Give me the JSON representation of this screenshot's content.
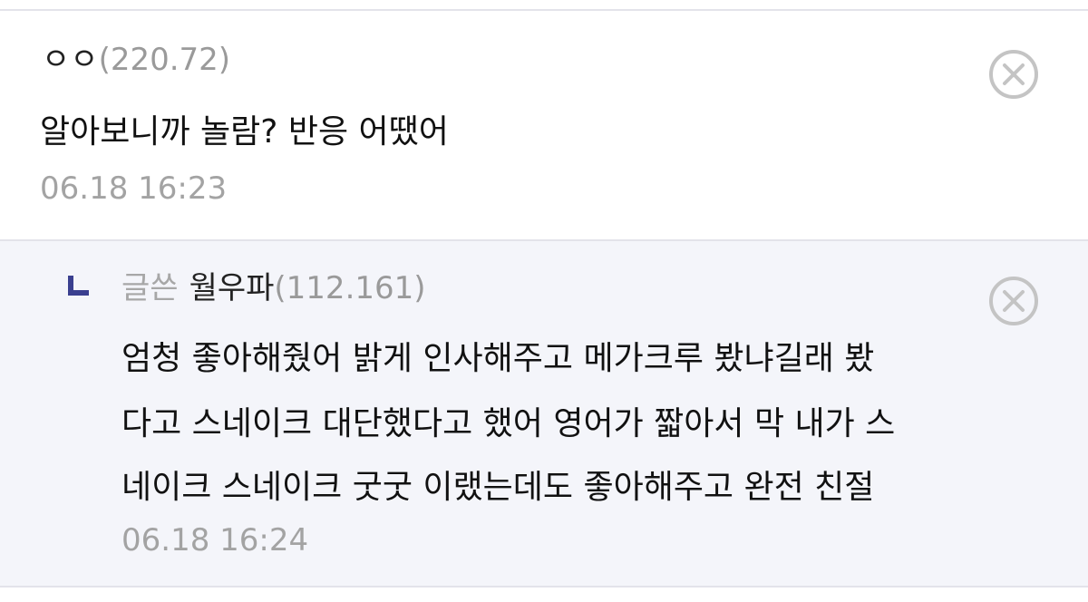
{
  "comment": {
    "nickname": "ㅇㅇ",
    "ip": "(220.72)",
    "text": "알아보니까 놀람? 반응 어땠어",
    "time": "06.18 16:23"
  },
  "reply": {
    "tag": "글쓴",
    "nickname": "월우파",
    "ip": "(112.161)",
    "lines": [
      "엄청 좋아해줬어 밝게 인사해주고 메가크루 봤냐길래 봤",
      "다고 스네이크 대단했다고 했어 영어가 짧아서 막 내가 스",
      "네이크 스네이크 굿굿 이랬는데도 좋아해주고 완전 친절"
    ],
    "time": "06.18 16:24"
  },
  "icons": {
    "delete": "close-circle-icon",
    "reply_marker": "reply-arrow-icon"
  },
  "colors": {
    "reply_background": "#f4f5fa",
    "reply_marker": "#3a3f8f",
    "meta_gray": "#9a9a9a"
  }
}
